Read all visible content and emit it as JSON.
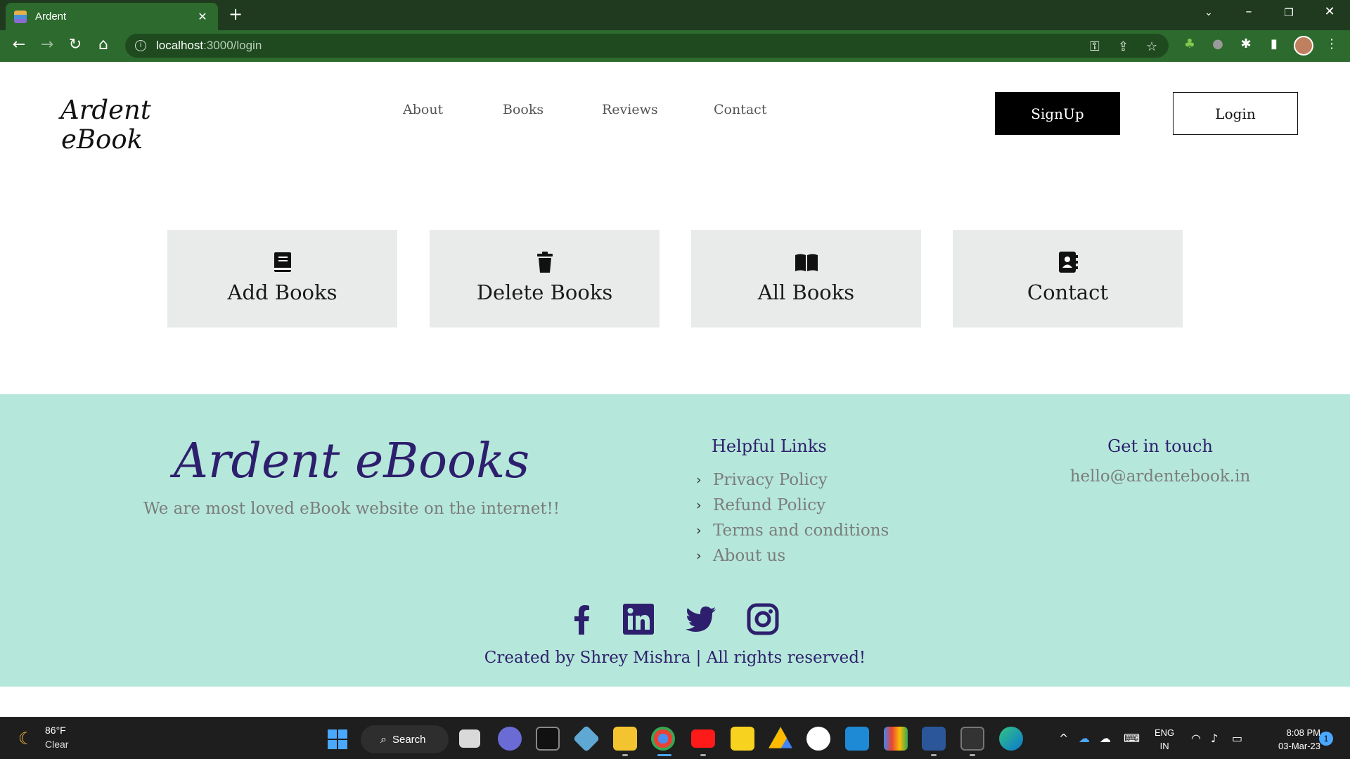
{
  "browser": {
    "tab_title": "Ardent",
    "url_host": "localhost",
    "url_path": ":3000/login"
  },
  "header": {
    "logo_line1": "Ardent",
    "logo_line2": "eBook",
    "nav": [
      "About",
      "Books",
      "Reviews",
      "Contact"
    ],
    "signup_label": "SignUp",
    "login_label": "Login"
  },
  "cards": [
    {
      "label": "Add Books",
      "icon": "book-icon"
    },
    {
      "label": "Delete Books",
      "icon": "trash-icon"
    },
    {
      "label": "All Books",
      "icon": "book-open-icon"
    },
    {
      "label": "Contact",
      "icon": "address-book-icon"
    }
  ],
  "footer": {
    "brand": "Ardent eBooks",
    "tagline": "We are most loved eBook website on the internet!!",
    "links_heading": "Helpful Links",
    "links": [
      "Privacy Policy",
      "Refund Policy",
      "Terms and conditions",
      "About us"
    ],
    "contact_heading": "Get in touch",
    "email": "hello@ardentebook.in",
    "social": [
      "facebook-icon",
      "linkedin-icon",
      "twitter-icon",
      "instagram-icon"
    ],
    "credit": "Created by Shrey Mishra | All rights reserved!"
  },
  "taskbar": {
    "weather_temp": "86°F",
    "weather_cond": "Clear",
    "search_label": "Search",
    "lang_line1": "ENG",
    "lang_line2": "IN",
    "time": "8:08 PM",
    "date": "03-Mar-23",
    "notification_count": "1"
  },
  "colors": {
    "browser_frame": "#1f3a1f",
    "browser_toolbar": "#2d6a2d",
    "card_bg": "#e9ebea",
    "footer_bg": "#b5e8da",
    "footer_accent": "#2e1f6e",
    "muted_text": "#7c7c7c"
  }
}
